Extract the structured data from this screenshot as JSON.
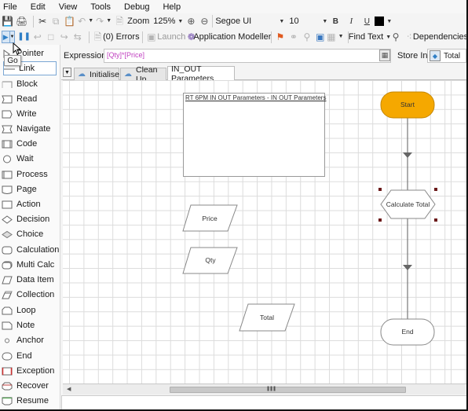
{
  "menu": [
    "File",
    "Edit",
    "View",
    "Tools",
    "Debug",
    "Help"
  ],
  "toolbar1": {
    "zoom_label": "Zoom",
    "zoom_value": "125%",
    "font_name": "Segoe UI",
    "font_size": "10",
    "bold": "B",
    "italic": "I",
    "underline": "U",
    "text_color": "#000000"
  },
  "toolbar2": {
    "errors_label": "(0) Errors",
    "launch_label": "Launch",
    "app_modeller_label": "Application Modeller",
    "find_text_label": "Find Text",
    "dependencies_label": "Dependencies"
  },
  "tooltip": "Go",
  "palette": [
    {
      "label": "Pointer",
      "shape": "pointer"
    },
    {
      "label": "Link",
      "shape": "link",
      "selected": true
    },
    {
      "label": "Block",
      "shape": "block"
    },
    {
      "label": "Read",
      "shape": "read"
    },
    {
      "label": "Write",
      "shape": "write"
    },
    {
      "label": "Navigate",
      "shape": "navigate"
    },
    {
      "label": "Code",
      "shape": "code"
    },
    {
      "label": "Wait",
      "shape": "wait"
    },
    {
      "label": "Process",
      "shape": "process"
    },
    {
      "label": "Page",
      "shape": "page"
    },
    {
      "label": "Action",
      "shape": "action"
    },
    {
      "label": "Decision",
      "shape": "decision"
    },
    {
      "label": "Choice",
      "shape": "choice"
    },
    {
      "label": "Calculation",
      "shape": "calculation"
    },
    {
      "label": "Multi Calc",
      "shape": "multicalc"
    },
    {
      "label": "Data Item",
      "shape": "dataitem"
    },
    {
      "label": "Collection",
      "shape": "collection"
    },
    {
      "label": "Loop",
      "shape": "loop"
    },
    {
      "label": "Note",
      "shape": "note"
    },
    {
      "label": "Anchor",
      "shape": "anchor"
    },
    {
      "label": "End",
      "shape": "end"
    },
    {
      "label": "Exception",
      "shape": "exception"
    },
    {
      "label": "Recover",
      "shape": "recover"
    },
    {
      "label": "Resume",
      "shape": "resume"
    }
  ],
  "expression": {
    "label": "Expression:",
    "value": "[Qty]*[Price]",
    "store_label": "Store In:",
    "store_value": "Total"
  },
  "tabs": [
    {
      "label": "Initialise",
      "icon": "cloud-icon"
    },
    {
      "label": "Clean Up",
      "icon": "cloud-icon"
    },
    {
      "label": "IN_OUT Parameters",
      "active": true
    }
  ],
  "canvas": {
    "block_title": "RT 6PM IN OUT Parameters - IN OUT Parameters",
    "nodes": {
      "start": "Start",
      "calc": "Calculate Total",
      "end": "End",
      "price": "Price",
      "qty": "Qty",
      "total": "Total"
    },
    "colors": {
      "start_fill": "#f5a800",
      "start_stroke": "#c48600",
      "selection_handle": "#6b1a1a"
    }
  }
}
